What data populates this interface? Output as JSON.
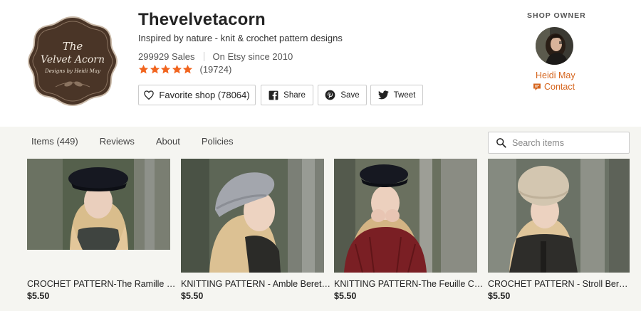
{
  "shop": {
    "name": "Thevelvetacorn",
    "tagline": "Inspired by nature - knit & crochet pattern designs",
    "sales": "299929 Sales",
    "since": "On Etsy since 2010",
    "rating_stars": 5,
    "rating_count": "(19724)",
    "logo": {
      "line1": "The",
      "line2": "Velvet Acorn",
      "line3": "Designs by Heidi May"
    }
  },
  "buttons": {
    "favorite": "Favorite shop (78064)",
    "share": "Share",
    "save": "Save",
    "tweet": "Tweet"
  },
  "owner": {
    "heading": "SHOP OWNER",
    "name": "Heidi May",
    "contact": "Contact"
  },
  "nav": {
    "tabs": [
      "Items (449)",
      "Reviews",
      "About",
      "Policies"
    ]
  },
  "search": {
    "placeholder": "Search items"
  },
  "listings": [
    {
      "title": "CROCHET PATTERN-The Ramille Cap",
      "price": "$5.50"
    },
    {
      "title": "KNITTING PATTERN - Amble Beret Pattern",
      "price": "$5.50"
    },
    {
      "title": "KNITTING PATTERN-The Feuille Cardigan",
      "price": "$5.50"
    },
    {
      "title": "CROCHET PATTERN - Stroll Beret (Toddler)",
      "price": "$5.50"
    }
  ],
  "colors": {
    "accent": "#d5641c",
    "star": "#f1641e",
    "band": "#f5f5f1",
    "logo_brown": "#4a3527"
  }
}
